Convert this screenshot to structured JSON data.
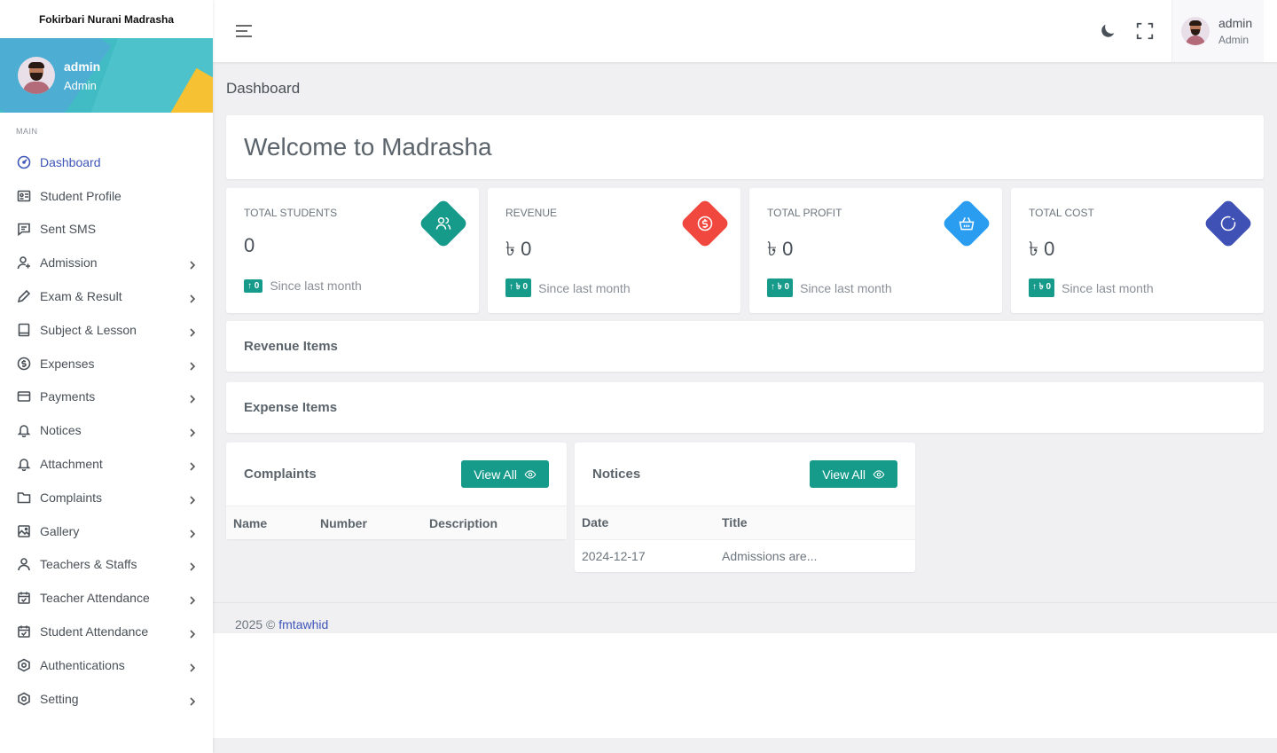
{
  "brand": "Fokirbari Nurani Madrasha",
  "profile": {
    "name": "admin",
    "role": "Admin"
  },
  "sidebar": {
    "section_title": "MAIN",
    "items": [
      {
        "label": "Dashboard",
        "icon": "dashboard-icon",
        "active": true,
        "chevron": false
      },
      {
        "label": "Student Profile",
        "icon": "id-card-icon",
        "chevron": false
      },
      {
        "label": "Sent SMS",
        "icon": "message-icon",
        "chevron": false
      },
      {
        "label": "Admission",
        "icon": "user-plus-icon",
        "chevron": true
      },
      {
        "label": "Exam & Result",
        "icon": "pencil-icon",
        "chevron": true
      },
      {
        "label": "Subject & Lesson",
        "icon": "book-icon",
        "chevron": true
      },
      {
        "label": "Expenses",
        "icon": "dollar-circle-icon",
        "chevron": true
      },
      {
        "label": "Payments",
        "icon": "credit-card-icon",
        "chevron": true
      },
      {
        "label": "Notices",
        "icon": "bell-icon",
        "chevron": true
      },
      {
        "label": "Attachment",
        "icon": "bell-icon",
        "chevron": true
      },
      {
        "label": "Complaints",
        "icon": "folder-icon",
        "chevron": true
      },
      {
        "label": "Gallery",
        "icon": "gallery-icon",
        "chevron": true
      },
      {
        "label": "Teachers & Staffs",
        "icon": "user-icon",
        "chevron": true
      },
      {
        "label": "Teacher Attendance",
        "icon": "calendar-check-icon",
        "chevron": true
      },
      {
        "label": "Student Attendance",
        "icon": "calendar-check-icon",
        "chevron": true
      },
      {
        "label": "Authentications",
        "icon": "shield-icon",
        "chevron": true
      },
      {
        "label": "Setting",
        "icon": "settings-icon",
        "chevron": true
      }
    ]
  },
  "topbar": {
    "user_name": "admin",
    "user_role": "Admin"
  },
  "page_title": "Dashboard",
  "welcome": "Welcome to Madrasha",
  "stats": [
    {
      "title": "TOTAL STUDENTS",
      "value": "0",
      "badge": "↑ 0",
      "foot": "Since last month",
      "color": "#169a8a",
      "icon": "users-icon"
    },
    {
      "title": "REVENUE",
      "value": "৳ 0",
      "badge": "↑ ৳ 0",
      "foot": "Since last month",
      "color": "#f0483e",
      "icon": "money-icon"
    },
    {
      "title": "TOTAL PROFIT",
      "value": "৳ 0",
      "badge": "↑ ৳ 0",
      "foot": "Since last month",
      "color": "#2b9df0",
      "icon": "basket-icon"
    },
    {
      "title": "TOTAL COST",
      "value": "৳ 0",
      "badge": "↑ ৳ 0",
      "foot": "Since last month",
      "color": "#3f51b5",
      "icon": "loader-icon"
    }
  ],
  "sections": {
    "revenue": "Revenue Items",
    "expense": "Expense Items"
  },
  "complaints": {
    "title": "Complaints",
    "button": "View All",
    "columns": [
      "Name",
      "Number",
      "Description"
    ],
    "rows": []
  },
  "notices": {
    "title": "Notices",
    "button": "View All",
    "columns": [
      "Date",
      "Title"
    ],
    "rows": [
      [
        "2024-12-17",
        "Admissions are..."
      ]
    ]
  },
  "footer": {
    "text": "2025 © ",
    "link": "fmtawhid"
  }
}
